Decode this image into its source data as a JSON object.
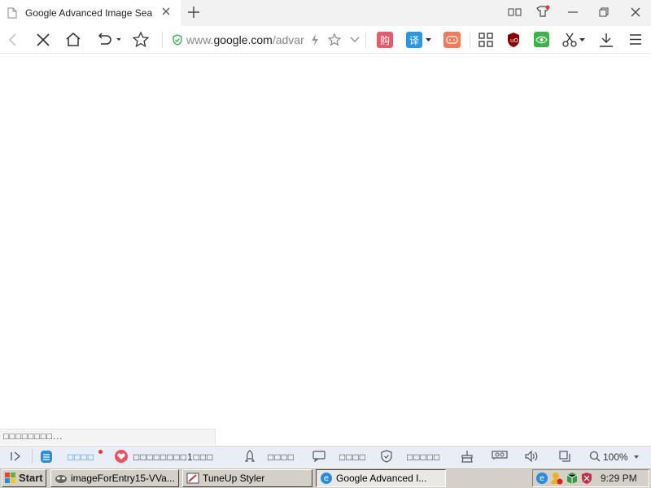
{
  "browser": {
    "tab": {
      "title": "Google Advanced Image Sea",
      "close_icon": "close-icon",
      "favicon": "page-icon"
    },
    "new_tab_icon": "plus-icon",
    "window_controls": [
      "tile-icon",
      "skin-icon",
      "minimize-icon",
      "restore-icon",
      "close-icon"
    ],
    "url": {
      "host": "www.google.com",
      "path": "/advar"
    },
    "accent_color": "#20a8e0"
  },
  "status_loading": "□□□□□□□□...",
  "statusbar": {
    "item1": "□□□□",
    "item2": "□□□□□□□□1□□□",
    "item3": "□□□□",
    "item4": "□□□□",
    "item5": "□□□□□",
    "zoom": "100%"
  },
  "taskbar": {
    "start": "Start",
    "buttons": [
      {
        "label": "imageForEntry15-VVa..."
      },
      {
        "label": "TuneUp Styler"
      },
      {
        "label": "Google Advanced I..."
      }
    ],
    "clock": "9:29 PM"
  }
}
